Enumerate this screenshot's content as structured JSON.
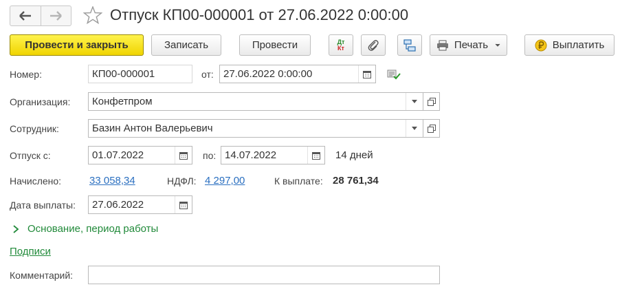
{
  "window": {
    "title": "Отпуск КП00-000001 от 27.06.2022 0:00:00"
  },
  "toolbar": {
    "post_close_label": "Провести и закрыть",
    "save_label": "Записать",
    "post_label": "Провести",
    "dt_label": "Дт",
    "kt_label": "Кт",
    "print_label": "Печать",
    "pay_label": "Выплатить"
  },
  "form": {
    "number_label": "Номер:",
    "number_value": "КП00-000001",
    "from_label": "от:",
    "date_value": "27.06.2022  0:00:00",
    "organization_label": "Организация:",
    "organization_value": "Конфетпром",
    "employee_label": "Сотрудник:",
    "employee_value": "Базин Антон Валерьевич",
    "vacation_from_label": "Отпуск с:",
    "vacation_from_value": "01.07.2022",
    "vacation_to_label": "по:",
    "vacation_to_value": "14.07.2022",
    "days_text": "14 дней",
    "accrued_label": "Начислено:",
    "accrued_value": "33 058,34",
    "ndfl_label": "НДФЛ:",
    "ndfl_value": "4 297,00",
    "to_pay_label": "К выплате:",
    "to_pay_value": "28 761,34",
    "payment_date_label": "Дата выплаты:",
    "payment_date_value": "27.06.2022",
    "basis_section": "Основание, период работы",
    "signatures_link": "Подписи",
    "comment_label": "Комментарий:",
    "comment_value": ""
  },
  "colors": {
    "primary_button": "#f0d400",
    "link": "#2a6fc0",
    "green": "#218a3a"
  }
}
